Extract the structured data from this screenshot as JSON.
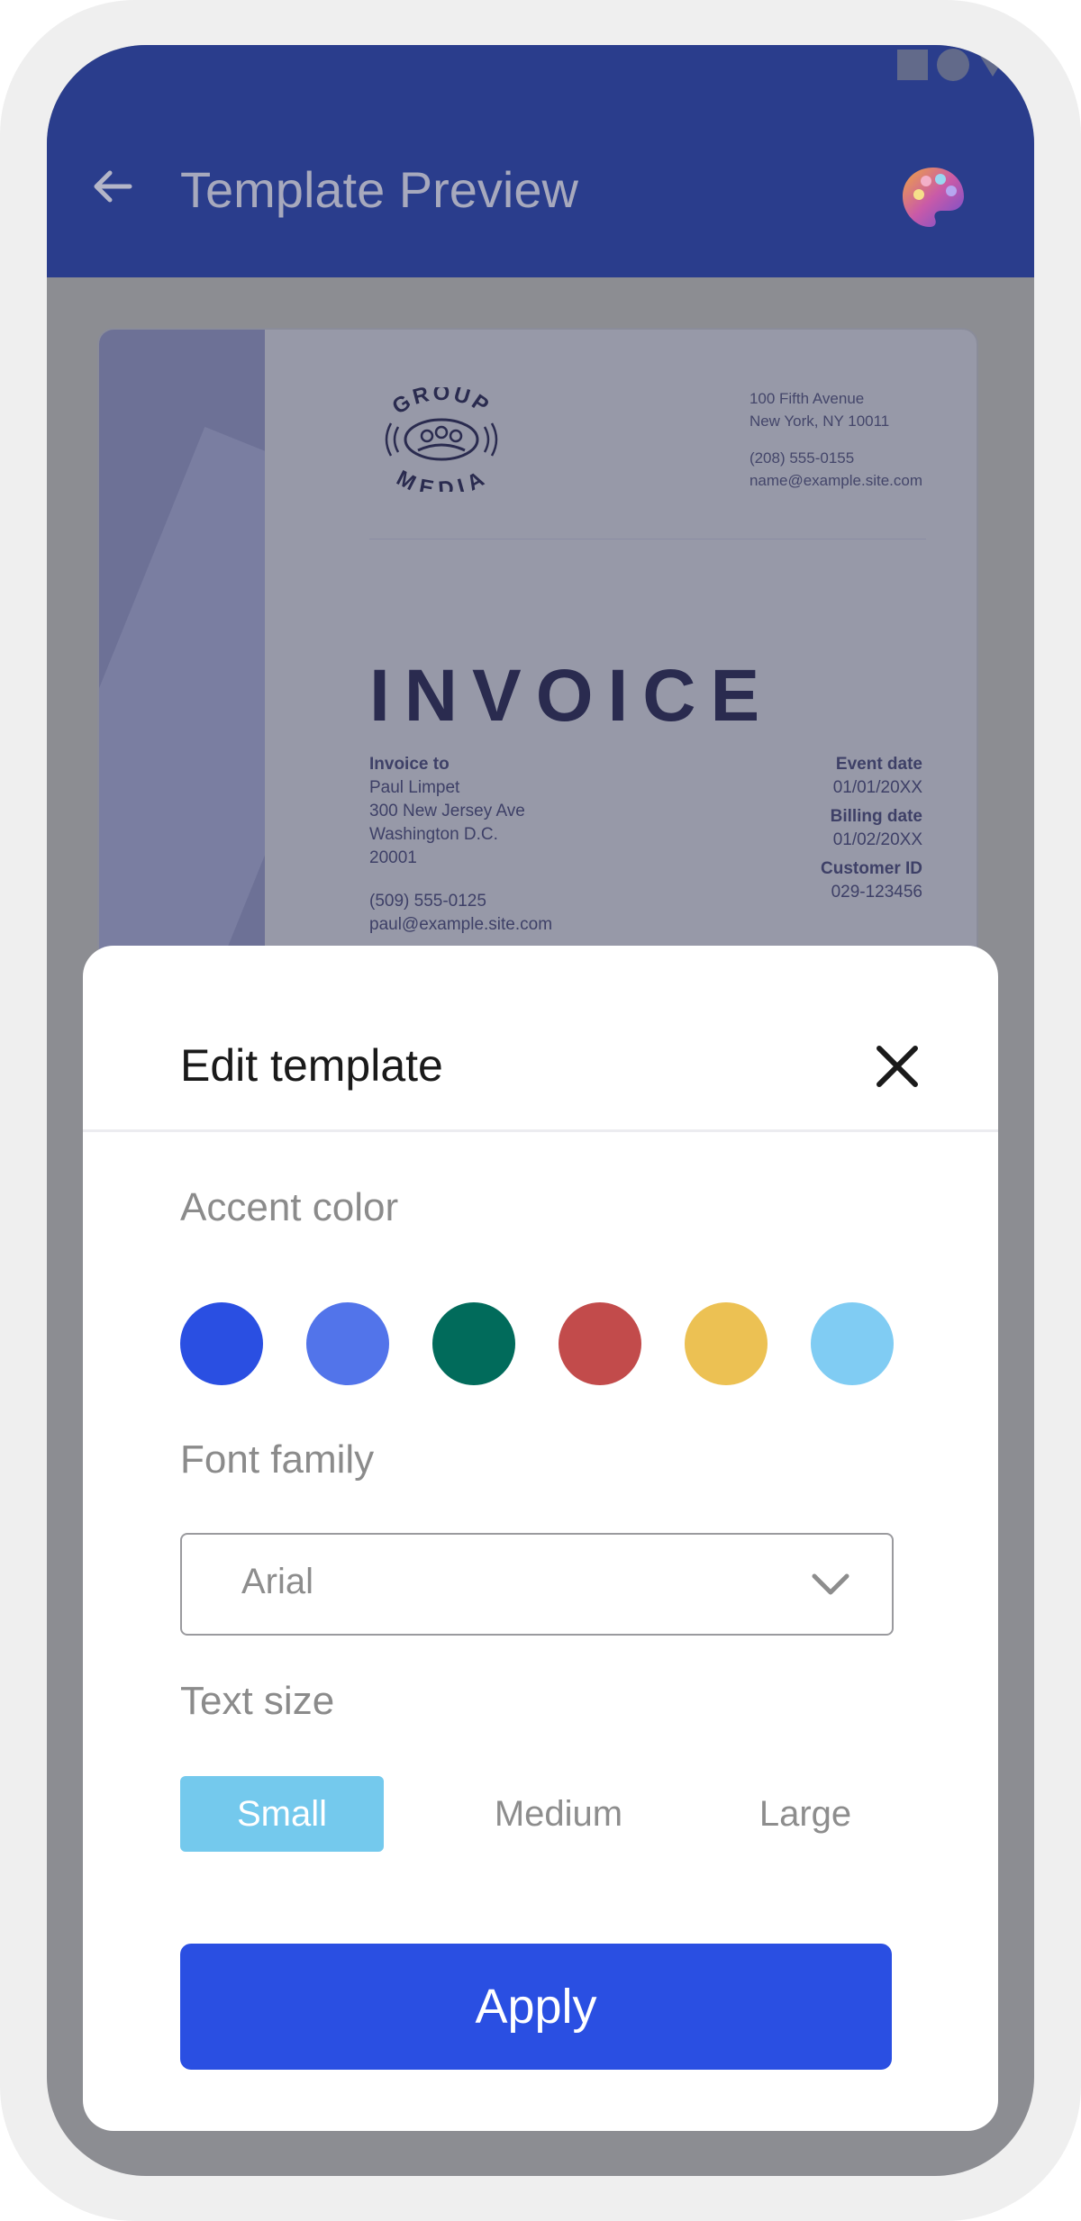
{
  "appbar": {
    "title": "Template Preview",
    "back_icon": "arrow-left-icon",
    "palette_icon": "palette-icon"
  },
  "invoice": {
    "logo_text_top": "GROUP",
    "logo_text_bottom": "MEDIA",
    "company_address_1": "100 Fifth Avenue",
    "company_address_2": "New York, NY 10011",
    "company_phone": "(208) 555-0155",
    "company_email": "name@example.site.com",
    "title": "INVOICE",
    "bill_to_label": "Invoice to",
    "bill_to_name": "Paul Limpet",
    "bill_to_street": "300 New Jersey Ave",
    "bill_to_city": "Washington D.C.",
    "bill_to_zip": "20001",
    "bill_to_phone": "(509) 555-0125",
    "bill_to_email": "paul@example.site.com",
    "event_date_label": "Event date",
    "event_date": "01/01/20XX",
    "billing_date_label": "Billing date",
    "billing_date": "01/02/20XX",
    "customer_id_label": "Customer ID",
    "customer_id": "029-123456"
  },
  "sheet": {
    "title": "Edit template",
    "close_icon": "close-icon",
    "accent_label": "Accent color",
    "accent_colors": [
      "#2a4fe2",
      "#5274ea",
      "#016b5b",
      "#c24b4b",
      "#ecc153",
      "#80ccf3"
    ],
    "font_label": "Font family",
    "font_value": "Arial",
    "size_label": "Text size",
    "sizes": [
      "Small",
      "Medium",
      "Large"
    ],
    "size_selected": "Small",
    "apply_label": "Apply"
  },
  "colors": {
    "appbar": "#2a3d8c",
    "accent": "#2a4fe2",
    "selected_size": "#74c9ed"
  }
}
